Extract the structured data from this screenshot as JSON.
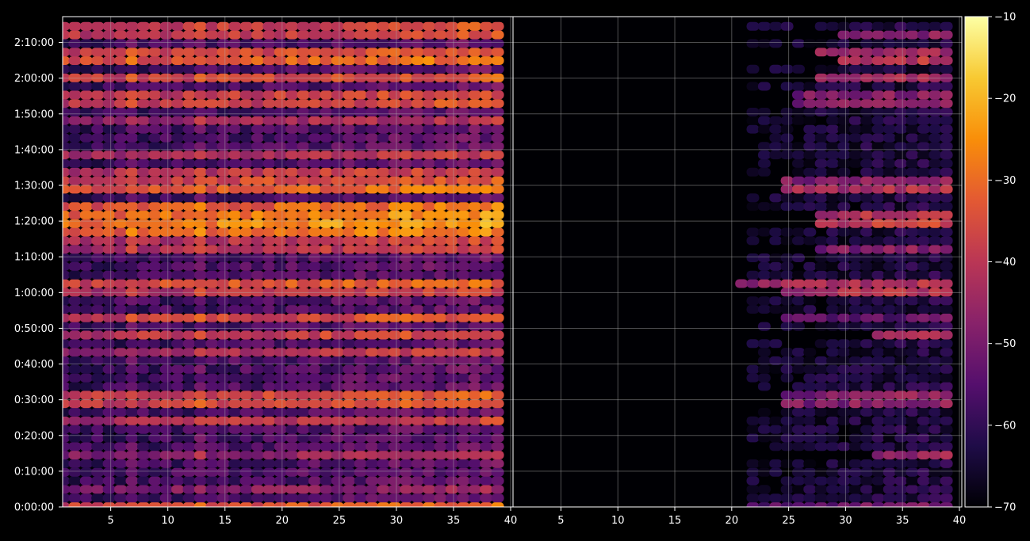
{
  "chart_data": {
    "type": "heatmap",
    "title": "",
    "panels": [
      {
        "name": "",
        "x_ticks": [
          5,
          10,
          15,
          20,
          25,
          30,
          35,
          40
        ],
        "xlim": [
          1,
          40
        ],
        "y_ticks": [
          "0:00:00",
          "0:10:00",
          "0:20:00",
          "0:30:00",
          "0:40:00",
          "0:50:00",
          "1:00:00",
          "1:10:00",
          "1:20:00",
          "1:30:00",
          "1:40:00",
          "1:50:00",
          "2:00:00",
          "2:10:00"
        ],
        "ylim_minutes": [
          0,
          135
        ],
        "grid": true,
        "hot_rows": [
          {
            "t": 0,
            "level": -38,
            "hot_from": 1
          },
          {
            "t": 5,
            "level": -52,
            "hot_from": 30
          },
          {
            "t": 15,
            "level": -50,
            "hot_from": 30
          },
          {
            "t": 24,
            "level": -44,
            "hot_from": 33
          },
          {
            "t": 30,
            "level": -40,
            "hot_from": 26
          },
          {
            "t": 43,
            "level": -46,
            "hot_from": 20
          },
          {
            "t": 47,
            "level": -42,
            "hot_from": 30
          },
          {
            "t": 52,
            "level": -40,
            "hot_from": 20
          },
          {
            "t": 60,
            "level": -44,
            "hot_from": 25
          },
          {
            "t": 63,
            "level": -38,
            "hot_from": 20
          },
          {
            "t": 71,
            "level": -45,
            "hot_from": 28
          },
          {
            "t": 75,
            "level": -44,
            "hot_from": 25
          },
          {
            "t": 78,
            "level": -34,
            "hot_from": 1
          },
          {
            "t": 80,
            "level": -30,
            "hot_from": 1
          },
          {
            "t": 82,
            "level": -32,
            "hot_from": 1
          },
          {
            "t": 84,
            "level": -36,
            "hot_from": 1
          },
          {
            "t": 88,
            "level": -36,
            "hot_from": 1
          },
          {
            "t": 91,
            "level": -40,
            "hot_from": 20
          },
          {
            "t": 93,
            "level": -44,
            "hot_from": 20
          },
          {
            "t": 99,
            "level": -46,
            "hot_from": 10
          },
          {
            "t": 107,
            "level": -48,
            "hot_from": 20
          },
          {
            "t": 114,
            "level": -42,
            "hot_from": 1
          },
          {
            "t": 119,
            "level": -40,
            "hot_from": 15
          },
          {
            "t": 121,
            "level": -40,
            "hot_from": 15
          },
          {
            "t": 124,
            "level": -36,
            "hot_from": 12
          },
          {
            "t": 126,
            "level": -40,
            "hot_from": 20
          },
          {
            "t": 133,
            "level": -42,
            "hot_from": 25
          },
          {
            "t": 135,
            "level": -42,
            "hot_from": 25
          }
        ]
      },
      {
        "name": "",
        "x_ticks": [
          5,
          10,
          15,
          20,
          25,
          30,
          35,
          40
        ],
        "xlim": [
          1,
          40
        ],
        "grid": true,
        "hot_rows": [
          {
            "t": 0,
            "level": -54,
            "hot_from": 22
          },
          {
            "t": 15,
            "level": -46,
            "hot_from": 33
          },
          {
            "t": 30,
            "level": -50,
            "hot_from": 25
          },
          {
            "t": 47,
            "level": -44,
            "hot_from": 33
          },
          {
            "t": 52,
            "level": -56,
            "hot_from": 25
          },
          {
            "t": 60,
            "level": -44,
            "hot_from": 25
          },
          {
            "t": 63,
            "level": -46,
            "hot_from": 21
          },
          {
            "t": 71,
            "level": -50,
            "hot_from": 28
          },
          {
            "t": 80,
            "level": -40,
            "hot_from": 28
          },
          {
            "t": 82,
            "level": -42,
            "hot_from": 28
          },
          {
            "t": 88,
            "level": -44,
            "hot_from": 25
          },
          {
            "t": 91,
            "level": -50,
            "hot_from": 25
          },
          {
            "t": 114,
            "level": -50,
            "hot_from": 26
          },
          {
            "t": 119,
            "level": -46,
            "hot_from": 28
          },
          {
            "t": 121,
            "level": -50,
            "hot_from": 28
          },
          {
            "t": 124,
            "level": -42,
            "hot_from": 30
          },
          {
            "t": 126,
            "level": -46,
            "hot_from": 28
          },
          {
            "t": 133,
            "level": -50,
            "hot_from": 30
          }
        ]
      }
    ],
    "colorbar": {
      "colormap": "inferno",
      "ticks": [
        "−10",
        "−20",
        "−30",
        "−40",
        "−50",
        "−60",
        "−70"
      ],
      "range": [
        -70,
        -10
      ]
    },
    "colors": {
      "background": "#000000",
      "text": "#ffffff",
      "grid": "#b0b0b0"
    }
  }
}
